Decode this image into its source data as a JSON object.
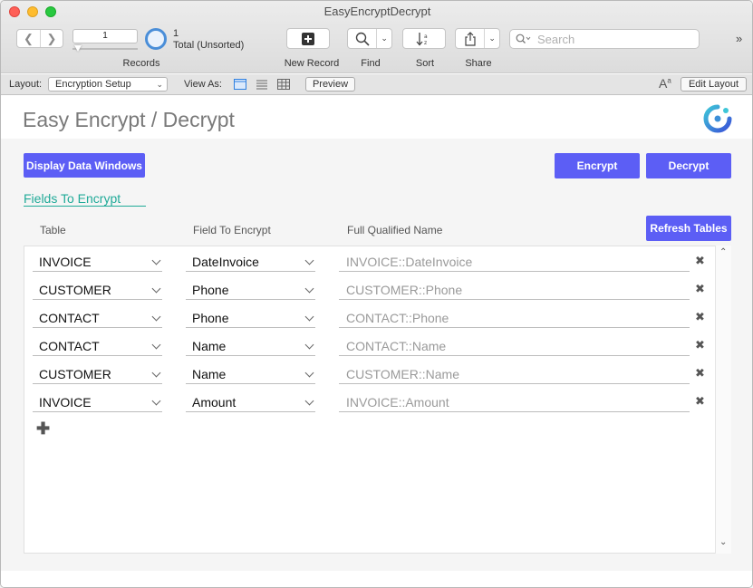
{
  "window": {
    "title": "EasyEncryptDecrypt"
  },
  "toolbar": {
    "record_value": "1",
    "record_count": "1",
    "record_total": "Total (Unsorted)",
    "records_label": "Records",
    "new_record_label": "New Record",
    "find_label": "Find",
    "sort_label": "Sort",
    "share_label": "Share",
    "search_placeholder": "Search"
  },
  "layoutbar": {
    "layout_label": "Layout:",
    "layout_value": "Encryption Setup",
    "view_as_label": "View As:",
    "preview_label": "Preview",
    "edit_layout_label": "Edit Layout"
  },
  "page": {
    "title": "Easy Encrypt / Decrypt",
    "display_data_windows_label": "Display Data Windows",
    "encrypt_label": "Encrypt",
    "decrypt_label": "Decrypt",
    "section_title": "Fields To Encrypt",
    "refresh_tables_label": "Refresh Tables",
    "columns": {
      "table": "Table",
      "field": "Field To Encrypt",
      "fqn": "Full Qualified Name"
    },
    "rows": [
      {
        "table": "INVOICE",
        "field": "DateInvoice",
        "fqn": "INVOICE::DateInvoice"
      },
      {
        "table": "CUSTOMER",
        "field": "Phone",
        "fqn": "CUSTOMER::Phone"
      },
      {
        "table": "CONTACT",
        "field": "Phone",
        "fqn": "CONTACT::Phone"
      },
      {
        "table": "CONTACT",
        "field": "Name",
        "fqn": "CONTACT::Name"
      },
      {
        "table": "CUSTOMER",
        "field": "Name",
        "fqn": "CUSTOMER::Name"
      },
      {
        "table": "INVOICE",
        "field": "Amount",
        "fqn": "INVOICE::Amount"
      }
    ]
  },
  "colors": {
    "accent": "#5c5ef5",
    "section": "#20aa98"
  },
  "icons": [
    "back-icon",
    "forward-icon",
    "records-pie-icon",
    "new-record-icon",
    "find-icon",
    "sort-icon",
    "share-icon",
    "search-icon",
    "overflow-icon",
    "form-view-icon",
    "list-view-icon",
    "table-view-icon",
    "font-size-icon",
    "app-logo",
    "delete-icon",
    "add-icon"
  ]
}
